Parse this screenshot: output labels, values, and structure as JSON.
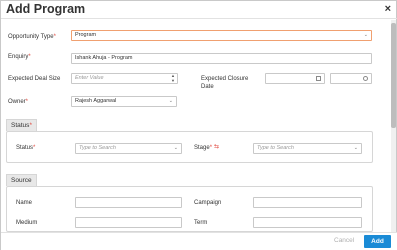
{
  "dialog": {
    "title": "Add Program",
    "close_glyph": "×"
  },
  "form": {
    "opportunity_type": {
      "label": "Opportunity Type",
      "value": "Program"
    },
    "enquiry": {
      "label": "Enquiry",
      "value": "Ishank Ahuja - Program"
    },
    "expected_deal_size": {
      "label": "Expected Deal Size",
      "placeholder": "Enter Value"
    },
    "expected_closure_date": {
      "label_line1": "Expected Closure",
      "label_line2": "Date"
    },
    "owner": {
      "label": "Owner",
      "value": "Rajesh Aggarwal"
    }
  },
  "status_section": {
    "tab": "Status",
    "status": {
      "label": "Status",
      "placeholder": "Type to Search"
    },
    "stage": {
      "label": "Stage",
      "placeholder": "Type to Search"
    }
  },
  "source_section": {
    "tab": "Source",
    "name": {
      "label": "Name"
    },
    "campaign": {
      "label": "Campaign"
    },
    "medium": {
      "label": "Medium"
    },
    "term": {
      "label": "Term"
    }
  },
  "footer": {
    "cancel": "Cancel",
    "add": "Add"
  },
  "colors": {
    "accent": "#1a8bd6",
    "required": "#e0463c",
    "focus_border": "#f0a070"
  },
  "icons": [
    "close-icon",
    "chevron-down-icon",
    "calendar-icon",
    "clock-icon",
    "spinner-arrows-icon",
    "shuffle-icon"
  ]
}
